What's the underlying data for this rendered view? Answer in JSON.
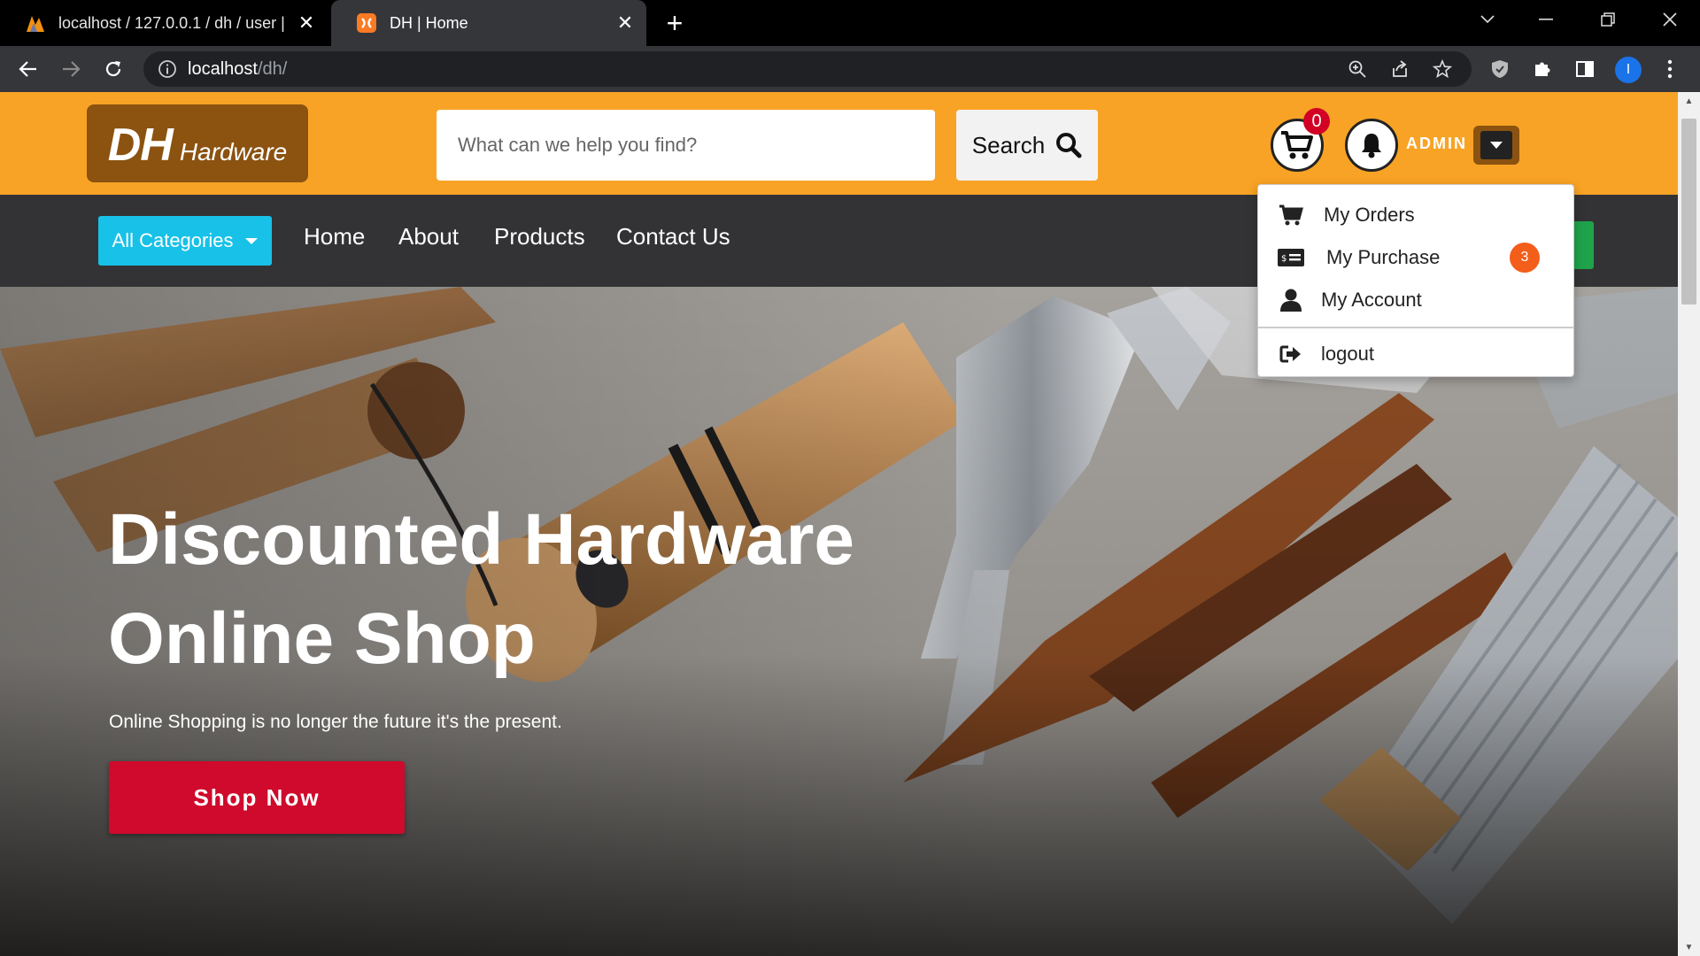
{
  "browser": {
    "tabs": [
      {
        "title": "localhost / 127.0.0.1 / dh / user |",
        "active": false
      },
      {
        "title": "DH | Home",
        "active": true
      }
    ],
    "url_host": "localhost",
    "url_path": "/dh/",
    "profile_initial": "I"
  },
  "header": {
    "logo_main": "DH",
    "logo_sub": "Hardware",
    "search_placeholder": "What can we help you find?",
    "search_button": "Search",
    "cart_count": "0",
    "user_label": "ADMIN"
  },
  "nav": {
    "categories_button": "All Categories",
    "links": [
      "Home",
      "About",
      "Products",
      "Contact Us"
    ]
  },
  "user_menu": {
    "items": [
      {
        "label": "My Orders",
        "icon": "cart-icon"
      },
      {
        "label": "My Purchase",
        "icon": "receipt-icon",
        "badge": "3"
      },
      {
        "label": "My Account",
        "icon": "user-icon"
      },
      {
        "label": "logout",
        "icon": "logout-icon"
      }
    ]
  },
  "hero": {
    "title_line1": "Discounted Hardware",
    "title_line2": "Online Shop",
    "subtitle": "Online Shopping is no longer the future it's the present.",
    "cta": "Shop Now"
  },
  "colors": {
    "header_bg": "#f8a325",
    "logo_bg": "#8b5210",
    "navbar_bg": "#333335",
    "categories_btn": "#17c1e8",
    "cta_bg": "#cf0a2c",
    "cart_badge": "#d10024",
    "menu_badge": "#f35e1b"
  }
}
